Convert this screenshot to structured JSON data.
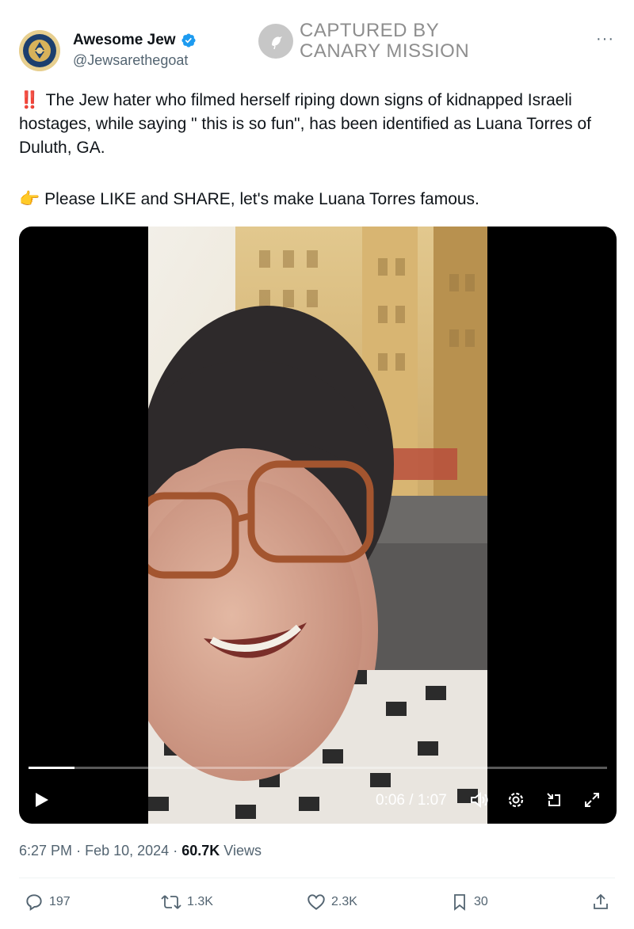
{
  "author": {
    "name": "Awesome Jew",
    "handle": "@Jewsarethegoat",
    "avatar_logo_text": "AWESOME JEWS",
    "verified_color": "#1d9bf0"
  },
  "watermark": {
    "line1": "CAPTURED BY",
    "line2": "CANARY MISSION"
  },
  "menu": {
    "more_label": "···"
  },
  "tweet": {
    "emoji1": "‼️",
    "paragraph1": "The Jew hater who filmed herself riping down signs of kidnapped Israeli hostages, while saying \" this is so fun\", has been identified as Luana Torres of Duluth, GA.",
    "emoji2": "👉",
    "paragraph2": "Please LIKE and SHARE, let's make Luana Torres famous."
  },
  "video": {
    "current_time": "0:06",
    "duration": "1:07",
    "time_display": "0:06 / 1:07",
    "progress_fraction": 0.08
  },
  "meta": {
    "time": "6:27 PM",
    "date": "Feb 10, 2024",
    "separator": "·",
    "views_count": "60.7K",
    "views_label": "Views"
  },
  "actions": {
    "replies": "197",
    "reposts": "1.3K",
    "likes": "2.3K",
    "bookmarks": "30"
  },
  "icons": [
    "verified-badge-icon",
    "canary-logo-icon",
    "more-icon",
    "play-icon",
    "volume-icon",
    "settings-icon",
    "minimize-icon",
    "fullscreen-icon",
    "reply-icon",
    "repost-icon",
    "like-icon",
    "bookmark-icon",
    "share-icon"
  ]
}
